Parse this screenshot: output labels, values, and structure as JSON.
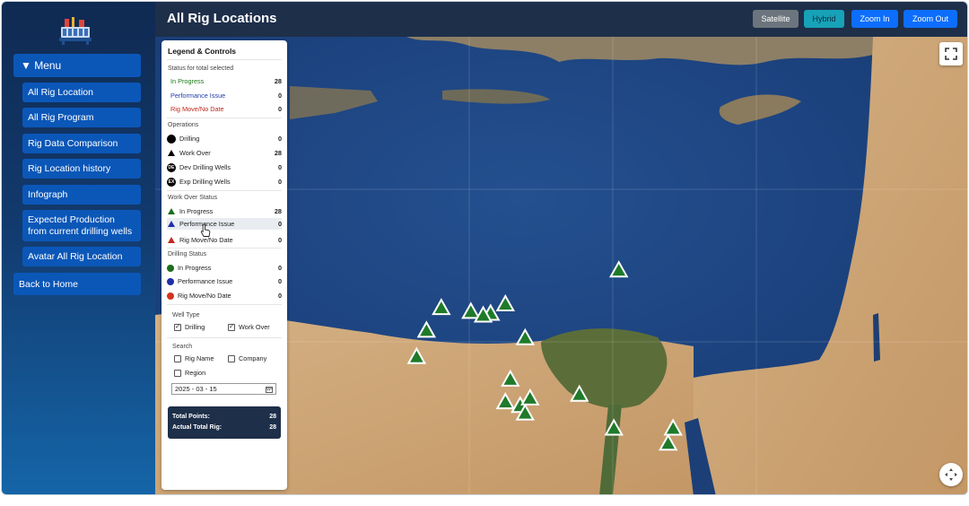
{
  "header": {
    "title": "All Rig Locations",
    "buttons": {
      "satellite": "Satellite",
      "hybrid": "Hybrid",
      "zoom_in": "Zoom In",
      "zoom_out": "Zoom Out"
    }
  },
  "sidebar": {
    "menu_label": "▼ Menu",
    "items": [
      {
        "label": "All Rig Location"
      },
      {
        "label": "All Rig Program"
      },
      {
        "label": "Rig Data Comparison"
      },
      {
        "label": "Rig Location history"
      },
      {
        "label": "Infograph"
      },
      {
        "label": "Expected Production from current drilling wells"
      },
      {
        "label": "Avatar All Rig Location"
      }
    ],
    "back_home": "Back to Home"
  },
  "legend": {
    "title": "Legend & Controls",
    "status_section": "Status for total selected",
    "status": [
      {
        "label": "In Progress",
        "value": "28",
        "color": "#1b7a1b"
      },
      {
        "label": "Performance Issue",
        "value": "0",
        "color": "#1f3fa8"
      },
      {
        "label": "Rig Move/No Date",
        "value": "0",
        "color": "#c0291f"
      }
    ],
    "operations_section": "Operations",
    "operations": [
      {
        "label": "Drilling",
        "value": "0",
        "icon": "black-circle-icon"
      },
      {
        "label": "Work Over",
        "value": "28",
        "icon": "black-triangle-icon"
      },
      {
        "label": "Dev Drilling Wells",
        "value": "0",
        "icon": "dev-badge-icon",
        "badge": "DE"
      },
      {
        "label": "Exp Drilling Wells",
        "value": "0",
        "icon": "exp-badge-icon",
        "badge": "EX"
      }
    ],
    "workover_section": "Work Over Status",
    "workover": [
      {
        "label": "In Progress",
        "value": "28",
        "color": "#1b6e1b"
      },
      {
        "label": "Performance Issue",
        "value": "0",
        "color": "#1f2fa8"
      },
      {
        "label": "Rig Move/No Date",
        "value": "0",
        "color": "#c0291f"
      }
    ],
    "drilling_section": "Drilling Status",
    "drilling": [
      {
        "label": "In Progress",
        "value": "0",
        "color": "#1b6e1b"
      },
      {
        "label": "Performance Issue",
        "value": "0",
        "color": "#1f2fa8"
      },
      {
        "label": "Rig Move/No Date",
        "value": "0",
        "color": "#d6331f"
      }
    ],
    "well_type_section": "Well Type",
    "well_type": {
      "drilling": "Drilling",
      "work_over": "Work Over"
    },
    "search_section": "Search",
    "search": {
      "rig_name": "Rig Name",
      "company": "Company",
      "region": "Region"
    },
    "date_value": "2025 - 03 - 15",
    "totals": {
      "points_label": "Total Points:",
      "points_value": "28",
      "rigs_label": "Actual Total Rig:",
      "rigs_value": "28"
    }
  },
  "map": {
    "marker_color": "#1f7a2a",
    "markers": [
      {
        "lon": 30.9,
        "lat": 31.0
      },
      {
        "lon": 27.3,
        "lat": 30.0
      },
      {
        "lon": 27.0,
        "lat": 29.4
      },
      {
        "lon": 27.9,
        "lat": 29.9
      },
      {
        "lon": 28.3,
        "lat": 29.85
      },
      {
        "lon": 28.15,
        "lat": 29.8
      },
      {
        "lon": 28.6,
        "lat": 30.1
      },
      {
        "lon": 26.8,
        "lat": 28.7
      },
      {
        "lon": 29.0,
        "lat": 29.2
      },
      {
        "lon": 28.7,
        "lat": 28.1
      },
      {
        "lon": 28.6,
        "lat": 27.5
      },
      {
        "lon": 28.9,
        "lat": 27.4
      },
      {
        "lon": 29.1,
        "lat": 27.6
      },
      {
        "lon": 29.0,
        "lat": 27.2
      },
      {
        "lon": 30.1,
        "lat": 27.7
      },
      {
        "lon": 30.8,
        "lat": 26.8
      },
      {
        "lon": 31.9,
        "lat": 26.4
      },
      {
        "lon": 32.0,
        "lat": 26.8
      }
    ]
  }
}
